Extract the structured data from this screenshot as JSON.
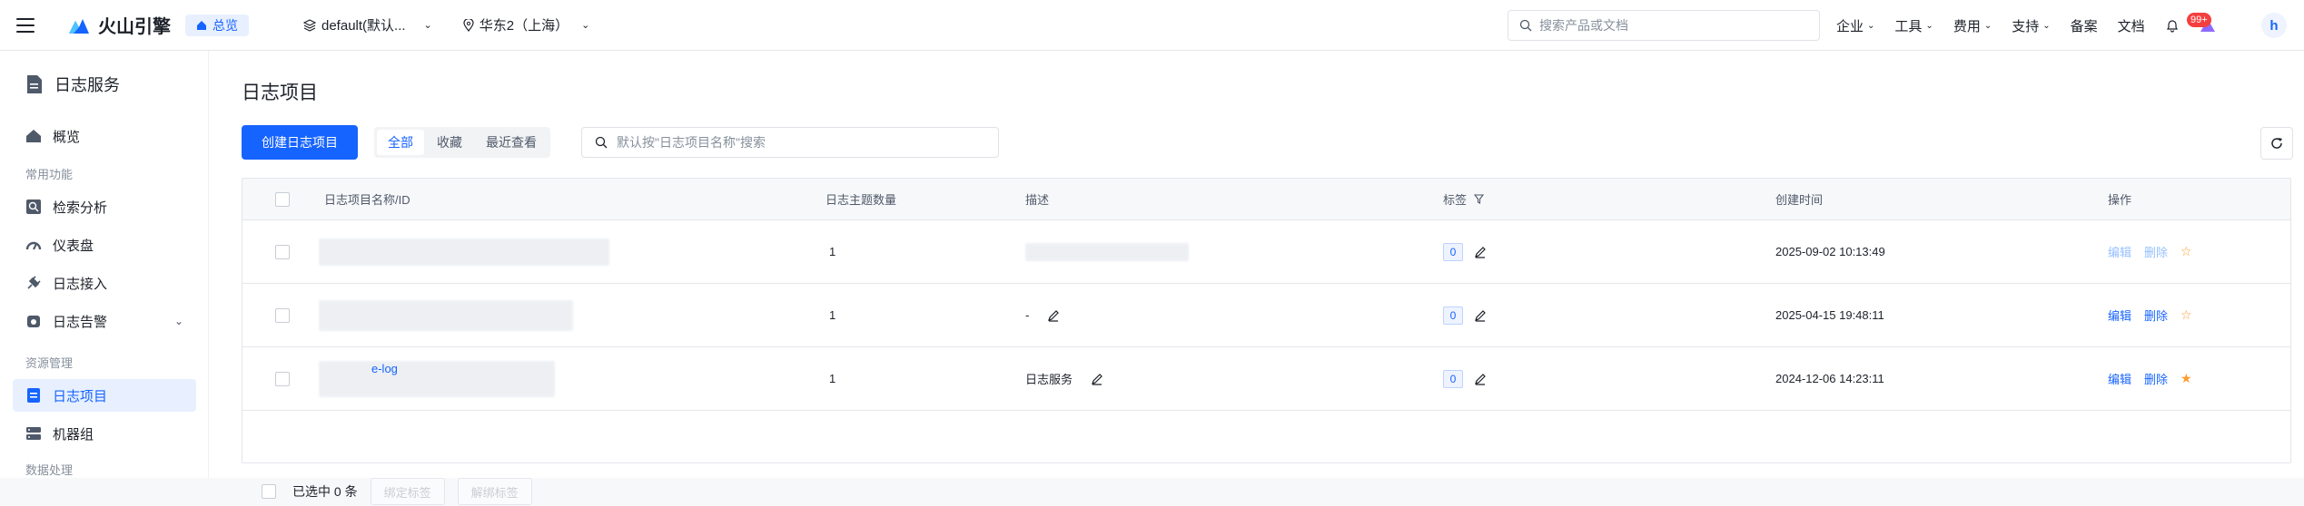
{
  "topbar": {
    "brand": "火山引擎",
    "overview": "总览",
    "project": "default(默认...",
    "region": "华东2（上海）",
    "search_placeholder": "搜索产品或文档",
    "nav": [
      "企业",
      "工具",
      "费用",
      "支持",
      "备案",
      "文档"
    ],
    "notif_badge": "99+",
    "avatar": "h"
  },
  "sidebar": {
    "title": "日志服务",
    "overview": "概览",
    "group1": "常用功能",
    "items1": [
      "检索分析",
      "仪表盘",
      "日志接入",
      "日志告警"
    ],
    "group2": "资源管理",
    "items2": [
      "日志项目",
      "机器组"
    ],
    "group3": "数据处理"
  },
  "main": {
    "title": "日志项目",
    "create_btn": "创建日志项目",
    "tabs": [
      "全部",
      "收藏",
      "最近查看"
    ],
    "search_placeholder": "默认按\"日志项目名称\"搜索",
    "columns": [
      "日志项目名称/ID",
      "日志主题数量",
      "描述",
      "标签",
      "创建时间",
      "操作"
    ],
    "rows": [
      {
        "name": "",
        "topics": "1",
        "desc": "",
        "tags": "0",
        "created": "2025-09-02 10:13:49",
        "edit": "编辑",
        "del": "删除",
        "fav": "☆"
      },
      {
        "name": "",
        "topics": "1",
        "desc": "-",
        "tags": "0",
        "created": "2025-04-15 19:48:11",
        "edit": "编辑",
        "del": "删除",
        "fav": "☆"
      },
      {
        "name": "e-log",
        "topics": "1",
        "desc": "日志服务",
        "tags": "0",
        "created": "2024-12-06 14:23:11",
        "edit": "编辑",
        "del": "删除",
        "fav": "★"
      }
    ],
    "selected_text": "已选中 0 条",
    "bind_tags": "绑定标签",
    "unbind_tags": "解绑标签"
  }
}
